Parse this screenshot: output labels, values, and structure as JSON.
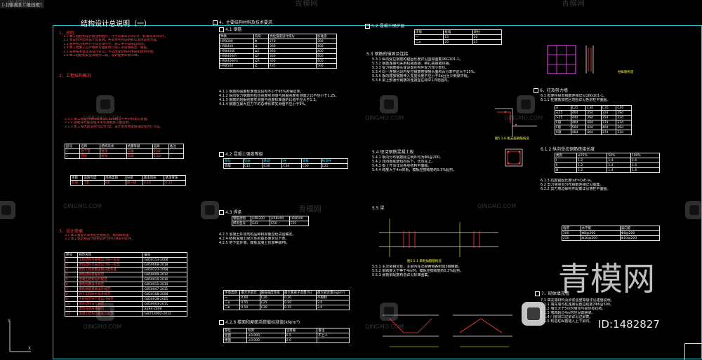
{
  "viewport": {
    "tab_label": "[-][俯视][二维线框]"
  },
  "watermark": {
    "word": "青模网",
    "latin": "QINGMO.COM",
    "big": "青模网",
    "id_label": "ID:1482827"
  },
  "sheet": {
    "title": "结构设计总说明（一）",
    "col1": {
      "h1": "1、总则",
      "lines1": [
        "1.1 本工程结构设计除注明者外，尺寸以毫米(mm)计，标高以米(m)计。",
        "1.2 本说明为结构设计总说明，各单体另有说明者以单体说明为准。",
        "1.3 图中所注构件尺寸均为净尺寸，施工中不得擅自修改。",
        "1.4 本工程施工应严格执行国家现行施工及验收规范、规程。",
        "1.5 未经技术鉴定或设计许可，不得改变结构的用途和使用环境。",
        "1.6 本工程结构安全等级为二级，设计使用年限50年。"
      ],
      "h2": "2、工程结构概况",
      "lines2": [
        "2.2.1 本工程室内地坪标高±0.000相当于绝对标高见总图。",
        "2.2.2 基础持力层及埋深详见基础施工图说明。",
        "2.2.3 本工程抗震设防烈度为7度，设计基本地震加速度值为0.10g。"
      ],
      "h3": "3、设计依据",
      "lines3": [
        "3.1 本工程设计采用的主要规范、规程和标准：",
        "3.2 本工程结构设计使用软件为PKPM系列软件。"
      ],
      "t1": [
        [
          "层号",
          "名称",
          "结构形式",
          "抗震等级",
          "层高",
          "备注"
        ],
        [
          "1",
          "地下室",
          "框架",
          "三级",
          "4.80",
          "-"
        ],
        [
          "2",
          "首层",
          "框架",
          "三级",
          "4.50",
          "-"
        ]
      ],
      "t2": [
        [
          "项目",
          "设防烈度",
          "场地类别",
          "分组",
          "基本风压",
          "基本雪压"
        ],
        [
          "取值",
          "7度",
          "Ⅱ类",
          "第一组",
          "0.40",
          "0.35"
        ]
      ],
      "codes_header": [
        "序号",
        "规范名称",
        "编号"
      ],
      "codes": [
        [
          "1",
          "工程结构可靠性设计统一标准",
          "GB50153-2008"
        ],
        [
          "2",
          "建筑结构可靠度设计统一标准",
          "GB50068-2018"
        ],
        [
          "3",
          "建筑工程抗震设防分类标准",
          "GB50223-2008"
        ],
        [
          "4",
          "建筑结构荷载规范",
          "GB50009-2012"
        ],
        [
          "5",
          "混凝土结构设计规范",
          "GB50010-2010"
        ],
        [
          "6",
          "建筑抗震设计规范",
          "GB50011-2010"
        ],
        [
          "7",
          "建筑地基基础设计规范",
          "GB50007-2011"
        ],
        [
          "8",
          "地下工程防水技术规范",
          "GB50108-2008"
        ],
        [
          "9",
          "人民防空地下室设计规范",
          "GB50038-2005"
        ],
        [
          "10",
          "砌体结构设计规范",
          "GB50003-2011"
        ],
        [
          "11",
          "建筑桩基技术规范",
          "JGJ94-2008"
        ],
        [
          "12",
          "混凝土结构工程施工规范",
          "GB/T14902-2012"
        ]
      ]
    },
    "col2": {
      "h4": "4、主要结构材料及技术要求",
      "h41": "4.1 钢筋",
      "rebar_header": [
        "种类",
        "符号",
        "抗拉强度设计值fy",
        "标准值"
      ],
      "rebar": [
        [
          "HPB300",
          "Φ",
          "270",
          "300"
        ],
        [
          "HRB400",
          "⊈",
          "360",
          "400"
        ],
        [
          "HRB400E",
          "⊈E",
          "360",
          "400"
        ],
        [
          "HRB400(F)",
          "⊈F",
          "360",
          "400"
        ],
        [
          "HRB400(R)",
          "⊈R",
          "360",
          "400"
        ],
        [
          "HRB500",
          "⊈",
          "435",
          "500"
        ]
      ],
      "notes41": [
        "4.1.1 钢筋的强度标准值应具有不小于95%的保证率。",
        "4.1.2 纵向受力钢筋的抗拉强度实测值与屈服强度实测值之比不应小于1.25。",
        "4.1.3 钢筋的屈服强度实测值与强度标准值的比值不应大于1.3。",
        "4.1.4 钢筋在最大拉力下的总伸长率实测值不应小于9%。"
      ],
      "h42": "4.2 混凝土强度等级",
      "concrete_header": [
        "部位",
        "垫层",
        "基础",
        "柱",
        "梁板",
        "构造柱"
      ],
      "concrete": [
        [
          "等级",
          "C15",
          "C30",
          "C30",
          "C30",
          "C25"
        ]
      ],
      "h43": "4.3 焊条",
      "weld": [
        [
          "钢筋类别",
          "HPB300",
          "HRB400",
          "HRB500"
        ],
        [
          "焊条型号",
          "E43",
          "E50",
          "E55"
        ]
      ],
      "notes43": [
        "4.2.3 混凝土外加剂的品种和掺量应经试验确定。",
        "4.2.4 结构混凝土耐久性的基本要求见下表。",
        "4.2.5 地下室外墙、底板混凝土抗渗等级P6。"
      ],
      "dur_header": [
        "环境类别",
        "最大水胶比",
        "最低强度等级",
        "最大氯离子含量(%)",
        "最大碱含量(kg/m³)"
      ],
      "dur": [
        [
          "一",
          "0.60",
          "C20",
          "0.30",
          "不限制"
        ],
        [
          "二a",
          "0.55",
          "C25",
          "0.20",
          "3.0"
        ],
        [
          "二b",
          "0.50",
          "C30",
          "0.15",
          "3.0"
        ]
      ],
      "h426": "4.2.6 楼面和屋面活荷载标准值(kN/m²)",
      "load_header": [
        "部位",
        "标高",
        "活荷载",
        "备注"
      ],
      "load": [
        [
          "屋面",
          "±0.000",
          "0.5",
          "不上人"
        ],
        [
          "楼面",
          "±0.000",
          "2.0",
          "-"
        ]
      ]
    },
    "col3": {
      "h5": "5.2 混凝土保护层",
      "cover": [
        [
          "环境",
          "板墙",
          "梁柱"
        ],
        [
          "一",
          "15",
          "20"
        ],
        [
          "二a",
          "20",
          "25"
        ]
      ],
      "h53": "5.3 钢筋的锚固及连接",
      "lines53": [
        "5.3.1 纵向受拉钢筋的锚固长度详见国标图集16G101-1。",
        "5.3.2 钢筋连接可采用机械连接、绑扎搭接或焊接。",
        "5.3.3 受力钢筋接头宜设置在构件受力较小部位。",
        "5.3.4 同一连接区段内受拉钢筋搭接接头面积百分率不宜大于25%。",
        "5.3.5 板的底部钢筋伸入支座长度不应小于5d且至少到梁中线。",
        "5.3.6 梁上部通长钢筋的连接宜在跨中1/3范围内。"
      ],
      "h54": "5.4 现浇钢筋混凝土板",
      "lines54": [
        "5.4.1 板内分布钢筋除注明外均为Φ6@200。",
        "5.4.2 双向板底筋短向在下，长向在上。",
        "5.4.3 板上开洞详见各层结构平面图。",
        "5.4.4 跨度大于4m的板，模板应按跨度的0.3%起拱。"
      ],
      "h55": "5.5 梁",
      "lines55": [
        "5.5.1 主次梁相交处，主梁内在次梁两侧各附加3组箍筋。",
        "5.5.2 梁跨度大于等于4m时，模板应按跨度的0.2%起拱。",
        "5.5.3 悬挑梁配筋构造详见标准图集。"
      ],
      "cap1": "图5.3.6 板支座钢筋构造",
      "cap2": "图5.5.1 梁附加箍筋构造"
    },
    "col4": {
      "h6": "6、柱及剪力墙",
      "lines6": [
        "6.1 框架柱纵向钢筋连接详见16G101-1。",
        "6.1.1 柱箍筋加密区范围详见各层柱平面图。"
      ],
      "anchor_header": [
        "d",
        "C25",
        "C30",
        "C35",
        "C40"
      ],
      "anchor": [
        [
          "≤25",
          "40d",
          "35d",
          "32d",
          "29d"
        ],
        [
          ">25",
          "44d",
          "39d",
          "35d",
          "32d"
        ],
        [
          "E级",
          "46d",
          "40d",
          "37d",
          "33d"
        ],
        [
          "F级",
          "50d",
          "44d",
          "40d",
          "36d"
        ],
        [
          "R级",
          "46d",
          "40d",
          "37d",
          "33d"
        ]
      ],
      "h62": "6.1.2 纵向受拉钢筋搭接长度",
      "lap_header": [
        "类别",
        "≤25%",
        "50%",
        "100%"
      ],
      "lap": [
        [
          "Ⅰ",
          "1.2",
          "1.4",
          "1.6"
        ],
        [
          "Ⅱ",
          "1.2",
          "1.4",
          "1.6"
        ],
        [
          "Ⅲ",
          "1.2",
          "1.4",
          "1.6"
        ]
      ],
      "lines62": [
        "6.1.3 抗震锚固长度laE=ζaE·la。",
        "6.2 剪力墙竖向分布钢筋连接详见图集。",
        "6.2.2 剪力墙边缘构件配筋详见墙柱平面图。"
      ],
      "wall": [
        [
          "墙厚",
          "水平筋",
          "竖向筋"
        ],
        [
          "200",
          "Φ8@200",
          "Φ8@200"
        ],
        [
          "250",
          "Φ10@200",
          "Φ10@200"
        ]
      ],
      "h7": "7、砌体填充墙",
      "lines7": [
        "7.1 填充墙材料及砂浆强度等级详见建施说明。",
        "7.1.1 填充墙与柱连接设置拉结筋2Φ6@500。",
        "7.1.2 墙长大于5m时墙顶与梁应有拉结。",
        "7.1.3 墙高超过4m时应设置圈梁。",
        "7.1.4 门窗洞口过梁详见过梁表。",
        "7.1.5 构造柱纵筋锚入上下梁内。"
      ],
      "cap_col": "柱纵筋构造"
    }
  }
}
